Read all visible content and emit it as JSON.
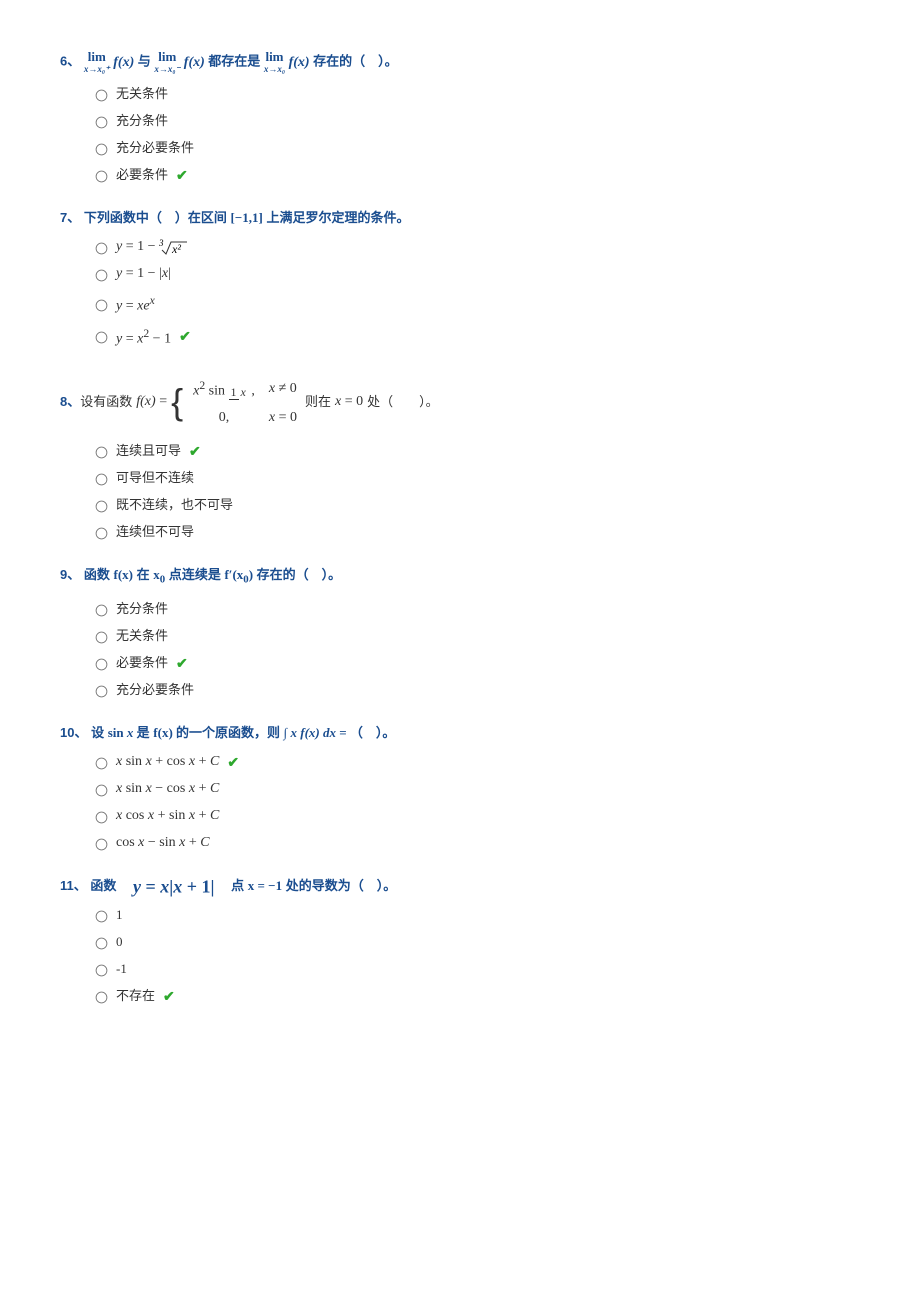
{
  "questions": [
    {
      "num": "6、",
      "stem_parts": [
        "都存在是",
        "存在的（　）。"
      ],
      "options": [
        {
          "label": "无关条件",
          "correct": false
        },
        {
          "label": "充分条件",
          "correct": false
        },
        {
          "label": "充分必要条件",
          "correct": false
        },
        {
          "label": "必要条件",
          "correct": true
        }
      ]
    },
    {
      "num": "7、",
      "stem_parts": [
        "下列函数中（　）在区间",
        "上满足罗尔定理的条件。"
      ],
      "interval": "[−1,1]",
      "options": [
        {
          "math": "y = 1 − ∛(x²)",
          "correct": false
        },
        {
          "math": "y = 1 − |x|",
          "correct": false
        },
        {
          "math": "y = x eˣ",
          "correct": false
        },
        {
          "math": "y = x² − 1",
          "correct": true
        }
      ]
    },
    {
      "num": "8、",
      "stem_parts": [
        "设有函数",
        "则在",
        "处（　　）。"
      ],
      "pt": "x = 0",
      "options": [
        {
          "label": "连续且可导",
          "correct": true
        },
        {
          "label": "可导但不连续",
          "correct": false
        },
        {
          "label": "既不连续，也不可导",
          "correct": false
        },
        {
          "label": "连续但不可导",
          "correct": false
        }
      ]
    },
    {
      "num": "9、",
      "stem_parts": [
        "函数",
        "在",
        "点连续是",
        "存在的（　）。"
      ],
      "math_parts": [
        "f(x)",
        "x₀",
        "f′(x₀)"
      ],
      "options": [
        {
          "label": "充分条件",
          "correct": false
        },
        {
          "label": "无关条件",
          "correct": false
        },
        {
          "label": "必要条件",
          "correct": true
        },
        {
          "label": "充分必要条件",
          "correct": false
        }
      ]
    },
    {
      "num": "10、",
      "stem_parts": [
        "设",
        "是",
        "的一个原函数，则",
        "（　）。"
      ],
      "math_parts": [
        "sin x",
        "f(x)",
        "∫ x f(x) dx ="
      ],
      "options": [
        {
          "math": "x sin x + cos x + C",
          "correct": true
        },
        {
          "math": "x sin x − cos x + C",
          "correct": false
        },
        {
          "math": "x cos x + sin x + C",
          "correct": false
        },
        {
          "math": "cos x − sin x + C",
          "correct": false
        }
      ]
    },
    {
      "num": "11、",
      "stem_parts": [
        "函数　",
        "　点",
        "处的导数为（　）。"
      ],
      "formula": "y = x|x + 1|",
      "pt": "x = −1",
      "options": [
        {
          "label": "1",
          "correct": false
        },
        {
          "label": "0",
          "correct": false
        },
        {
          "label": "-1",
          "correct": false
        },
        {
          "label": "不存在",
          "correct": true
        }
      ]
    }
  ],
  "check_mark": "✔"
}
